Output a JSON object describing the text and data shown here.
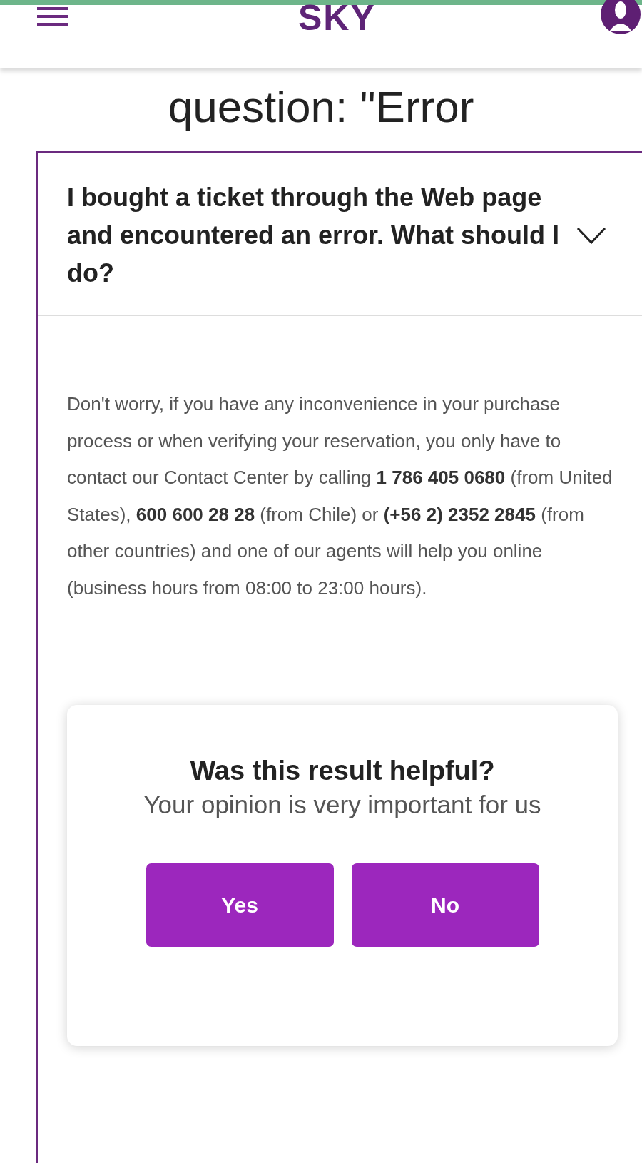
{
  "header": {
    "logo": "SKY"
  },
  "page_heading": "question: \"Error",
  "faq": {
    "question": "I bought a ticket through the Web page and encountered an error. What should I do?",
    "expanded": true,
    "answer": "Don't worry, if you have any inconvenience in your purchase process or when verifying your reservation, you only have to contact our Contact Center by calling **1 786 405 0680** (from United States), **600 600 28 28** (from Chile) or **(+56 2) 2352 2845** (from other countries) and one of our agents will help you online (business hours from 08:00 to 23:00 hours)."
  },
  "feedback": {
    "title": "Was this result helpful?",
    "subtitle": "Your opinion is very important for us",
    "buttons": [
      "Yes",
      "No"
    ]
  }
}
